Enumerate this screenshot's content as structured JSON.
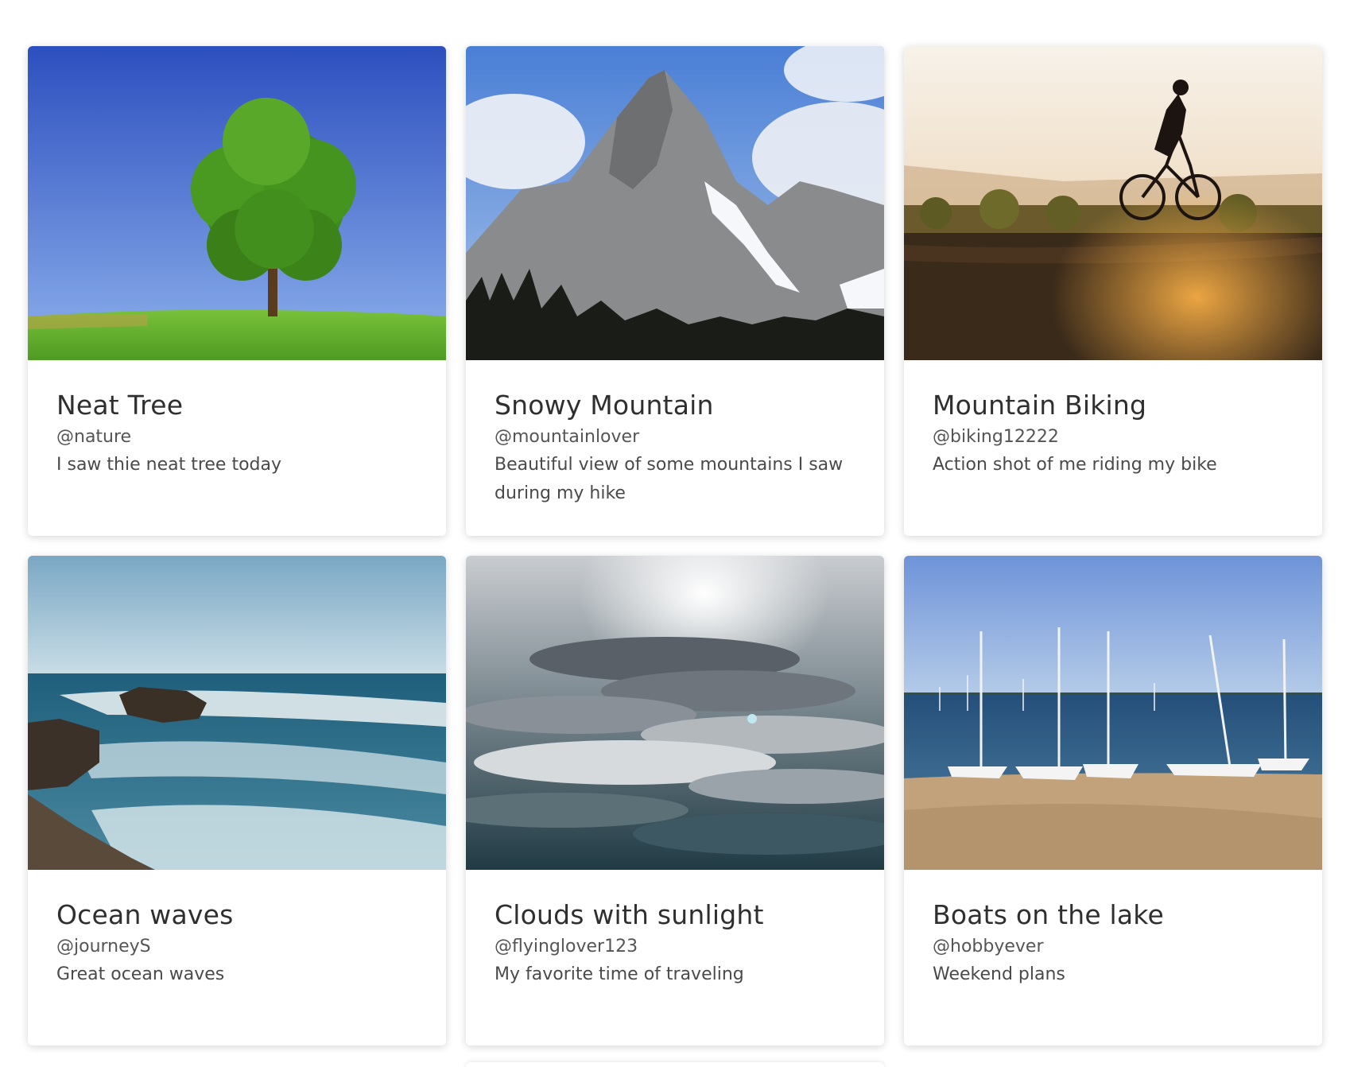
{
  "cards": [
    {
      "image": "tree-photo",
      "title": "Neat Tree",
      "handle": "@nature",
      "description": "I saw thie neat tree today"
    },
    {
      "image": "mountain-photo",
      "title": "Snowy Mountain",
      "handle": "@mountainlover",
      "description": "Beautiful view of some mountains I saw during my hike"
    },
    {
      "image": "biking-photo",
      "title": "Mountain Biking",
      "handle": "@biking12222",
      "description": "Action shot of me riding my bike"
    },
    {
      "image": "ocean-photo",
      "title": "Ocean waves",
      "handle": "@journeyS",
      "description": "Great ocean waves"
    },
    {
      "image": "clouds-photo",
      "title": "Clouds with sunlight",
      "handle": "@flyinglover123",
      "description": "My favorite time of traveling"
    },
    {
      "image": "boats-photo",
      "title": "Boats on the lake",
      "handle": "@hobbyever",
      "description": "Weekend plans"
    }
  ],
  "colors": {
    "title": "#2f2f2f",
    "text": "#4a4a4a",
    "card_bg": "#ffffff"
  }
}
